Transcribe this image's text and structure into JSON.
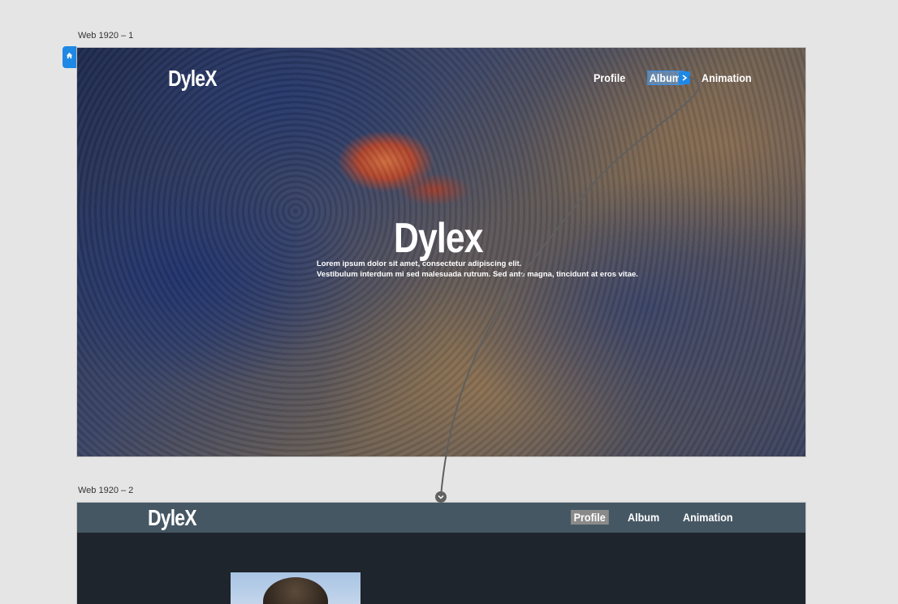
{
  "artboards": [
    {
      "label": "Web 1920 – 1",
      "logo": "DyleX",
      "nav": [
        "Profile",
        "Album",
        "Animation"
      ],
      "hero": {
        "title": "Dylex",
        "line1": "Lorem ipsum dolor sit amet, consectetur adipiscing elit.",
        "line2": "Vestibulum interdum mi sed malesuada rutrum. Sed ante magna, tincidunt at eros vitae."
      }
    },
    {
      "label": "Web 1920 – 2",
      "logo": "DyleX",
      "nav": [
        "Profile",
        "Album",
        "Animation"
      ]
    }
  ],
  "colors": {
    "canvas": "#e5e5e5",
    "accent": "#1e88e5",
    "header2": "#465764",
    "body2": "#1f252d"
  },
  "icons": [
    "home-icon",
    "chevron-right-icon",
    "chevron-down-icon"
  ]
}
